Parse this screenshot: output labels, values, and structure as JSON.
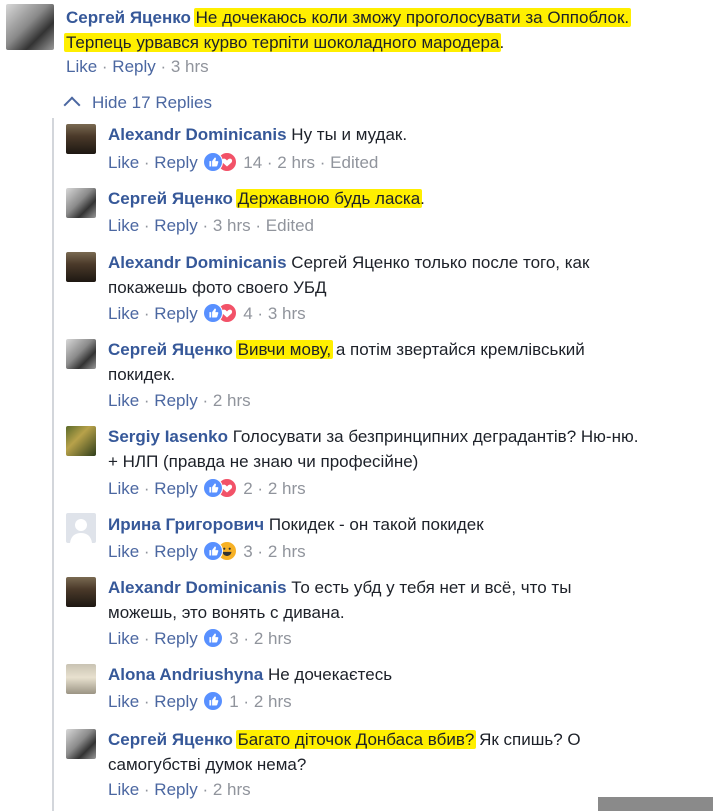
{
  "comments": [
    {
      "author": "Сергей Яценко",
      "hl": "Не дочекаюсь коли зможу проголосувати за Оппоблок.",
      "hl2": "Терпець урвався курво терпіти шоколадного мародера",
      "tail": ".",
      "like": "Like",
      "reply": "Reply",
      "time": "3 hrs"
    },
    {
      "author": "Alexandr Dominicanis",
      "text": "Ну ты и мудак.",
      "like": "Like",
      "reply": "Reply",
      "count": "14",
      "time": "2 hrs",
      "edited": "Edited"
    },
    {
      "author": "Сергей Яценко",
      "hl": "Державною будь ласка",
      "tail": ".",
      "like": "Like",
      "reply": "Reply",
      "time": "3 hrs",
      "edited": "Edited"
    },
    {
      "author": "Alexandr Dominicanis",
      "text": "Сергей Яценко только после того, как",
      "text2": "покажешь фото своего УБД",
      "like": "Like",
      "reply": "Reply",
      "count": "4",
      "time": "3 hrs"
    },
    {
      "author": "Сергей Яценко",
      "hl": "Вивчи мову,",
      "tail": " а потім звертайся кремлівський",
      "text2": "покидек.",
      "like": "Like",
      "reply": "Reply",
      "time": "2 hrs"
    },
    {
      "author": "Sergiy Iasenko",
      "text": "Голосувати за безпринципних деградантів? Ню-ню.",
      "text2": "+ НЛП (правда не знаю чи професійне)",
      "like": "Like",
      "reply": "Reply",
      "count": "2",
      "time": "2 hrs"
    },
    {
      "author": "Ирина Григорович",
      "text": "Покидек - он такой покидек",
      "like": "Like",
      "reply": "Reply",
      "count": "3",
      "time": "2 hrs"
    },
    {
      "author": "Alexandr Dominicanis",
      "text": "То есть убд у тебя нет и всё, что ты",
      "text2": "можешь, это вонять с дивана.",
      "like": "Like",
      "reply": "Reply",
      "count": "3",
      "time": "2 hrs"
    },
    {
      "author": "Alona Andriushyna",
      "text": "Не дочекаєтесь",
      "like": "Like",
      "reply": "Reply",
      "count": "1",
      "time": "2 hrs"
    },
    {
      "author": "Сергей Яценко",
      "hl": "Багато діточок Донбаса вбив?",
      "tail": " Як спишь? О",
      "text2": "самогубстві думок нема?",
      "like": "Like",
      "reply": "Reply",
      "time": "2 hrs"
    }
  ],
  "hide_replies": "Hide 17 Replies",
  "separator": " · ",
  "icons": {
    "like": "like-reaction-icon",
    "love": "love-reaction-icon",
    "haha": "haha-reaction-icon",
    "chevron": "chevron-up-icon"
  },
  "colors": {
    "link": "#365899",
    "action": "#4b67a1",
    "meta": "#90949c",
    "highlight": "#ffef00"
  }
}
